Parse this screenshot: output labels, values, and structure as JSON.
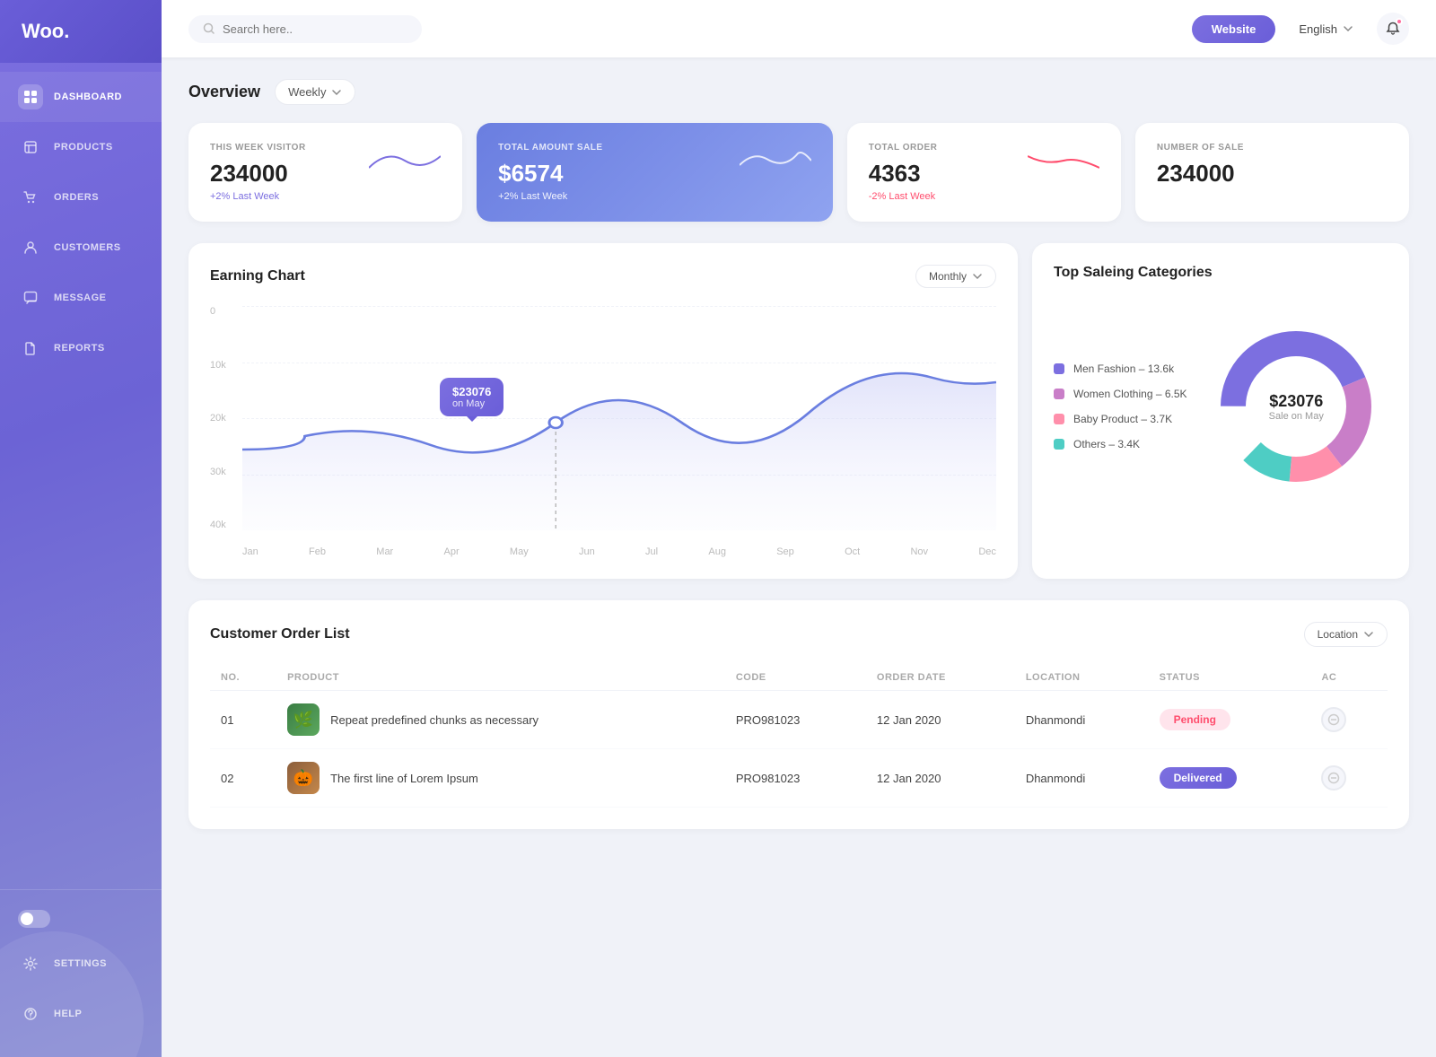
{
  "brand": {
    "name": "Woo."
  },
  "sidebar": {
    "items": [
      {
        "id": "dashboard",
        "label": "DASHBOARD",
        "icon": "grid-icon",
        "active": true
      },
      {
        "id": "products",
        "label": "PRODUCTS",
        "icon": "box-icon",
        "active": false
      },
      {
        "id": "orders",
        "label": "ORDERS",
        "icon": "cart-icon",
        "active": false
      },
      {
        "id": "customers",
        "label": "CUSTOMERS",
        "icon": "person-icon",
        "active": false
      },
      {
        "id": "message",
        "label": "MESSAGE",
        "icon": "chat-icon",
        "active": false
      },
      {
        "id": "reports",
        "label": "REPORTS",
        "icon": "file-icon",
        "active": false
      }
    ],
    "bottom": [
      {
        "id": "settings",
        "label": "SETTINGS",
        "icon": "gear-icon"
      },
      {
        "id": "help",
        "label": "HELP",
        "icon": "help-icon"
      }
    ]
  },
  "header": {
    "search_placeholder": "Search here..",
    "website_button": "Website",
    "language": "English"
  },
  "overview": {
    "title": "Overview",
    "filter": "Weekly",
    "stats": [
      {
        "id": "visitors",
        "label": "THIS WEEK VISITOR",
        "value": "234000",
        "change": "+2% Last Week",
        "change_type": "pos"
      },
      {
        "id": "total_sale",
        "label": "TOTAL AMOUNT SALE",
        "value": "$6574",
        "change": "+2% Last Week",
        "change_type": "pos",
        "highlight": true
      },
      {
        "id": "total_order",
        "label": "TOTAL ORDER",
        "value": "4363",
        "change": "-2% Last Week",
        "change_type": "neg"
      },
      {
        "id": "number_sale",
        "label": "NUMBER OF SALE",
        "value": "234000",
        "change": "",
        "change_type": ""
      }
    ]
  },
  "earning_chart": {
    "title": "Earning Chart",
    "filter": "Monthly",
    "y_labels": [
      "0",
      "10k",
      "20k",
      "30k",
      "40k"
    ],
    "x_labels": [
      "Jan",
      "Feb",
      "Mar",
      "Apr",
      "May",
      "Jun",
      "Jul",
      "Aug",
      "Sep",
      "Oct",
      "Nov",
      "Dec"
    ],
    "tooltip_value": "$23076",
    "tooltip_label": "on May"
  },
  "top_categories": {
    "title": "Top Saleing Categories",
    "donut_center_value": "$23076",
    "donut_center_label": "Sale on May",
    "items": [
      {
        "label": "Men Fashion – 13.6k",
        "color": "#7c6fe0"
      },
      {
        "label": "Women Clothing – 6.5K",
        "color": "#c97ec8"
      },
      {
        "label": "Baby Product – 3.7K",
        "color": "#ff8fab"
      },
      {
        "label": "Others – 3.4K",
        "color": "#4ecdc4"
      }
    ]
  },
  "order_list": {
    "title": "Customer Order List",
    "filter": "Location",
    "columns": [
      "NO.",
      "PRODUCT",
      "CODE",
      "ORDER DATE",
      "LOCATION",
      "STATUS",
      "AC"
    ],
    "rows": [
      {
        "no": "01",
        "product": "Repeat predefined chunks as necessary",
        "product_icon": "🌿",
        "product_icon_type": "green",
        "code": "PRO981023",
        "order_date": "12 Jan 2020",
        "location": "Dhanmondi",
        "status": "Pending",
        "status_type": "pending"
      },
      {
        "no": "02",
        "product": "The first line of Lorem Ipsum",
        "product_icon": "🎃",
        "product_icon_type": "brown",
        "code": "PRO981023",
        "order_date": "12 Jan 2020",
        "location": "Dhanmondi",
        "status": "Delivered",
        "status_type": "delivered"
      }
    ]
  }
}
